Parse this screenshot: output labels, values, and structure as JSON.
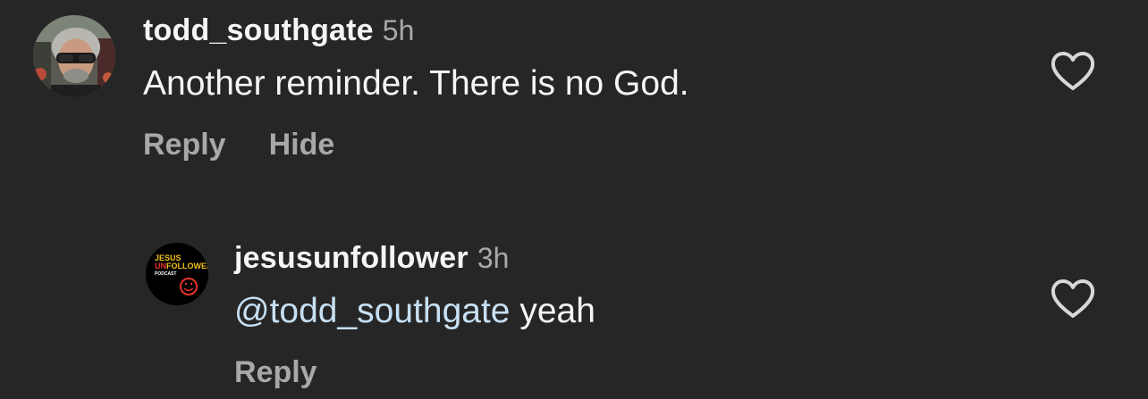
{
  "comments": [
    {
      "username": "todd_southgate",
      "time": "5h",
      "text": "Another reminder. There is no God.",
      "actions": {
        "reply": "Reply",
        "hide": "Hide"
      },
      "avatar": "profile-photo-icon"
    }
  ],
  "replies": [
    {
      "username": "jesusunfollower",
      "time": "3h",
      "mention": "@todd_southgate",
      "text": " yeah",
      "actions": {
        "reply": "Reply"
      },
      "avatar_logo": {
        "line1": "JESUS",
        "line2_prefix": "UN",
        "line2_rest": "FOLLOWER",
        "line3": "PODCAST"
      }
    }
  ],
  "icons": {
    "like": "heart-outline-icon"
  },
  "colors": {
    "background": "#262626",
    "primary_text": "#f5f5f5",
    "secondary_text": "#a8a8a8",
    "mention": "#c7e0f4",
    "logo_accent": "#e8322b",
    "logo_yellow": "#f2c21b"
  }
}
